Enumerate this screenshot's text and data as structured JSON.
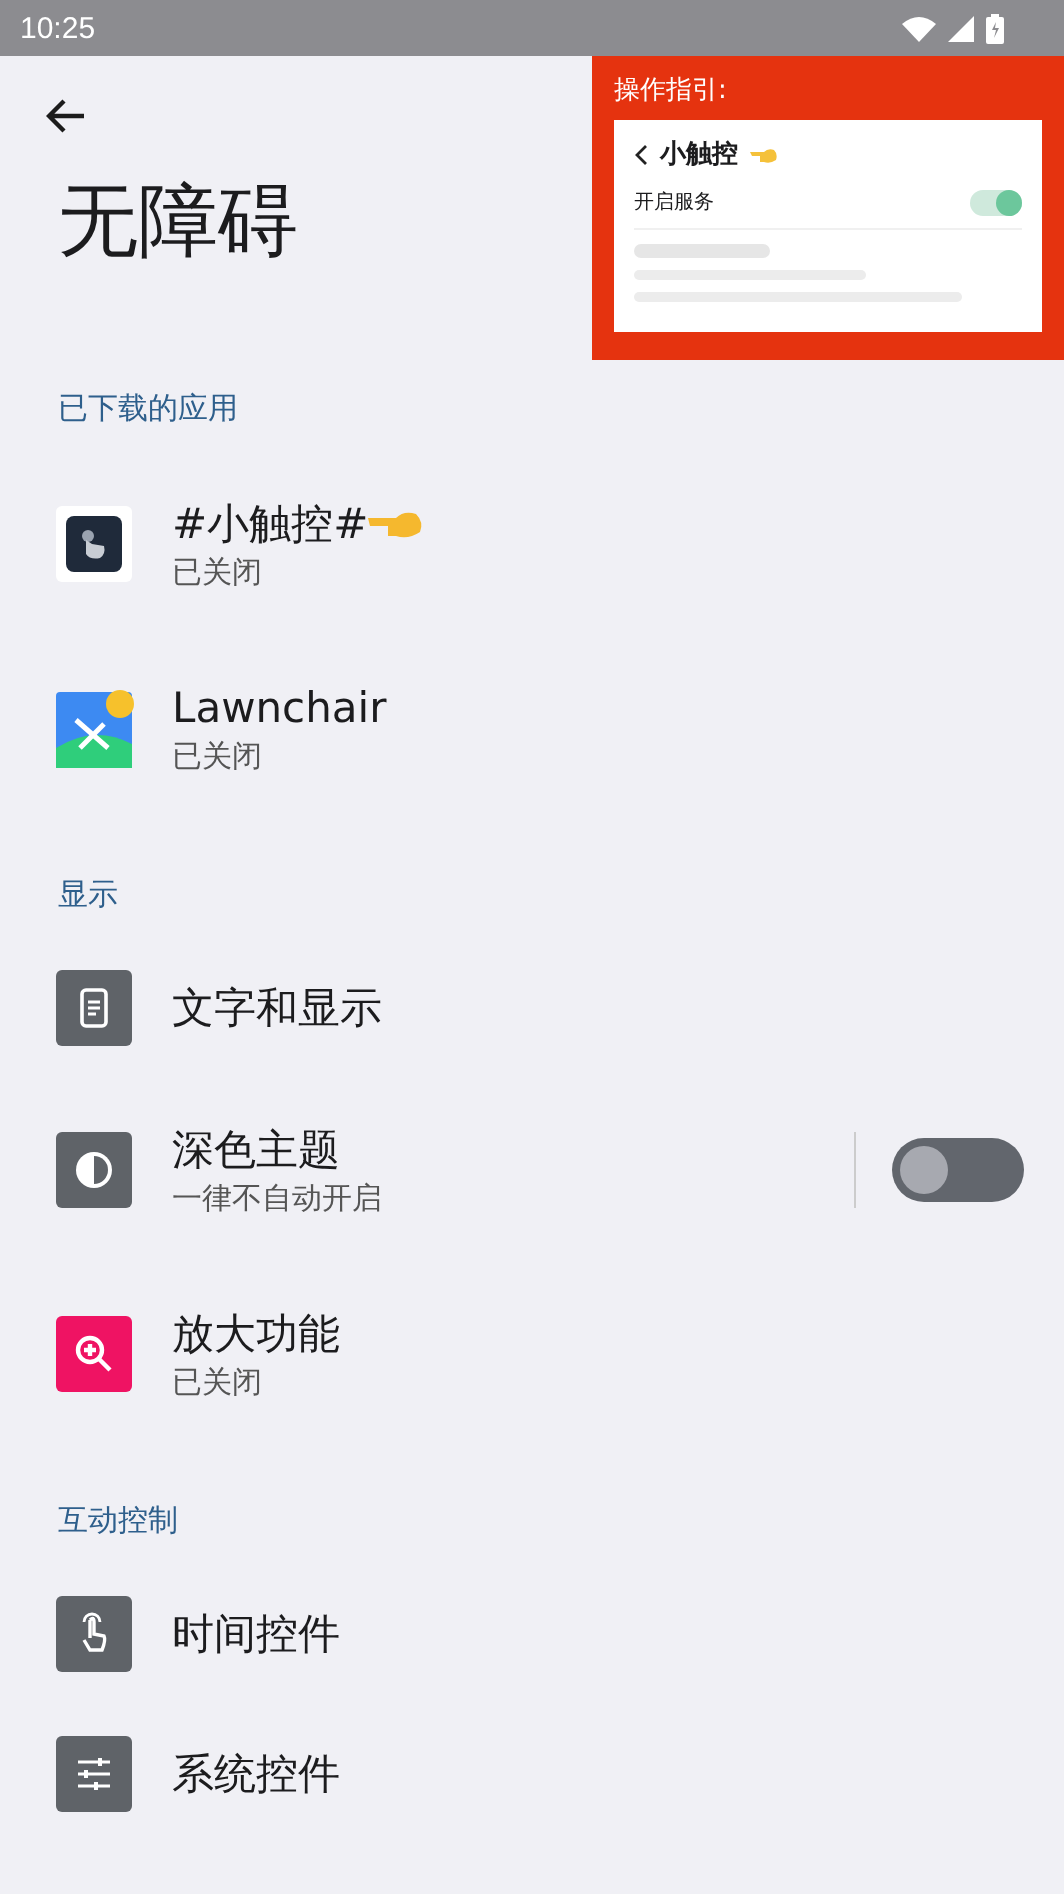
{
  "status_bar": {
    "time": "10:25"
  },
  "guide": {
    "title": "操作指引:",
    "app_name": "小触控",
    "service_label": "开启服务",
    "service_toggle": {
      "on": true
    }
  },
  "title": "无障碍",
  "sections": [
    {
      "header": "已下载的应用",
      "items": [
        {
          "kind": "touch",
          "title": "#小触控#",
          "pointer": true,
          "subtitle": "已关闭"
        },
        {
          "kind": "launcher",
          "title": "Lawnchair",
          "subtitle": "已关闭"
        }
      ]
    },
    {
      "header": "显示",
      "items": [
        {
          "kind": "display",
          "title": "文字和显示"
        },
        {
          "kind": "contrast",
          "title": "深色主题",
          "subtitle": "一律不自动开启",
          "toggle": {
            "on": false
          }
        },
        {
          "kind": "magnify",
          "title": "放大功能",
          "subtitle": "已关闭"
        }
      ]
    },
    {
      "header": "互动控制",
      "items": [
        {
          "kind": "timing",
          "title": "时间控件"
        },
        {
          "kind": "controls",
          "title": "系统控件"
        }
      ]
    }
  ]
}
